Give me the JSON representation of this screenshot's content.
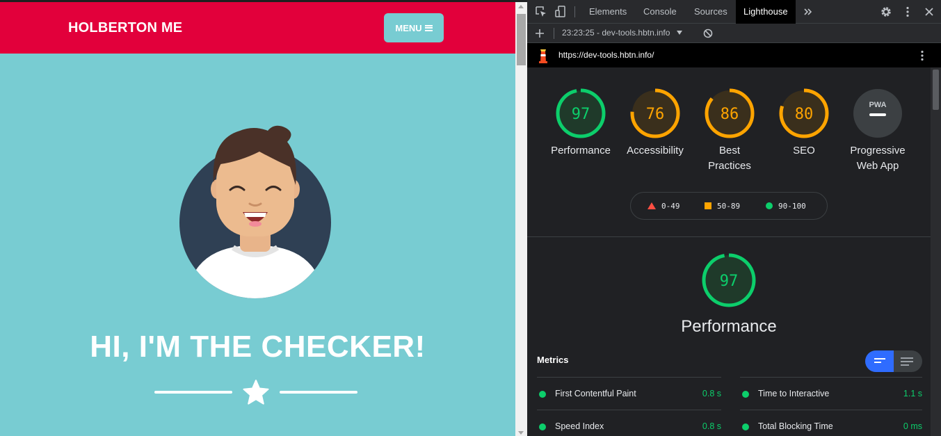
{
  "site": {
    "brand": "HOLBERTON ME",
    "menu_label": "MENU",
    "hero_title": "HI, I'M THE CHECKER!"
  },
  "devtools": {
    "tabs": [
      "Elements",
      "Console",
      "Sources",
      "Lighthouse"
    ],
    "active_tab": "Lighthouse",
    "report_select": "23:23:25 - dev-tools.hbtn.info",
    "url": "https://dev-tools.hbtn.info/",
    "scores": [
      {
        "label_line1": "Performance",
        "label_line2": "",
        "value": "97",
        "rating": "pass"
      },
      {
        "label_line1": "Accessibility",
        "label_line2": "",
        "value": "76",
        "rating": "average"
      },
      {
        "label_line1": "Best",
        "label_line2": "Practices",
        "value": "86",
        "rating": "average"
      },
      {
        "label_line1": "SEO",
        "label_line2": "",
        "value": "80",
        "rating": "average"
      },
      {
        "label_line1": "Progressive",
        "label_line2": "Web App",
        "badge": "PWA",
        "rating": "na"
      }
    ],
    "legend": {
      "fail": "0-49",
      "average": "50-89",
      "pass": "90-100"
    },
    "performance": {
      "score": "97",
      "title": "Performance"
    },
    "metrics_title": "Metrics",
    "metrics": [
      {
        "name": "First Contentful Paint",
        "value": "0.8 s"
      },
      {
        "name": "Time to Interactive",
        "value": "1.1 s"
      },
      {
        "name": "Speed Index",
        "value": "0.8 s"
      },
      {
        "name": "Total Blocking Time",
        "value": "0 ms"
      }
    ]
  },
  "colors": {
    "navbar": "#e2003b",
    "page_bg": "#78ccd2",
    "pass": "#0cce6b",
    "average": "#ffa400",
    "fail": "#ff4e42",
    "toggle_active": "#2f6cff"
  }
}
